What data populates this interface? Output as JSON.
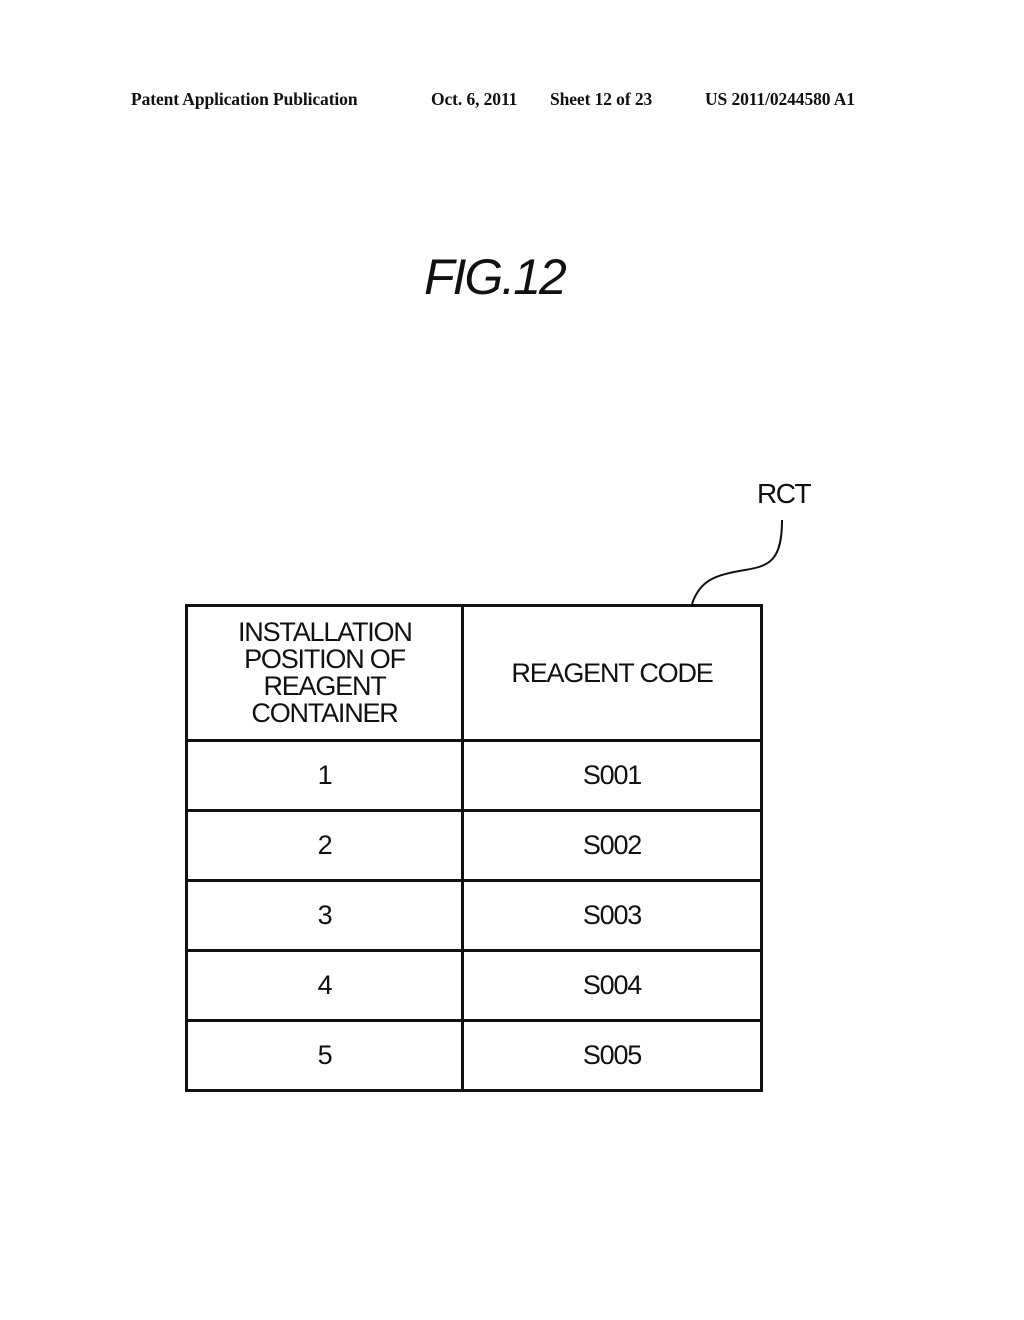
{
  "header": {
    "publication": "Patent Application Publication",
    "date": "Oct. 6, 2011",
    "sheet": "Sheet 12 of 23",
    "number": "US 2011/0244580 A1"
  },
  "figure": {
    "title": "FIG.12",
    "reference_label": "RCT"
  },
  "table": {
    "headers": [
      "INSTALLATION POSITION OF REAGENT CONTAINER",
      "REAGENT CODE"
    ],
    "rows": [
      {
        "position": "1",
        "code": "S001"
      },
      {
        "position": "2",
        "code": "S002"
      },
      {
        "position": "3",
        "code": "S003"
      },
      {
        "position": "4",
        "code": "S004"
      },
      {
        "position": "5",
        "code": "S005"
      }
    ]
  }
}
